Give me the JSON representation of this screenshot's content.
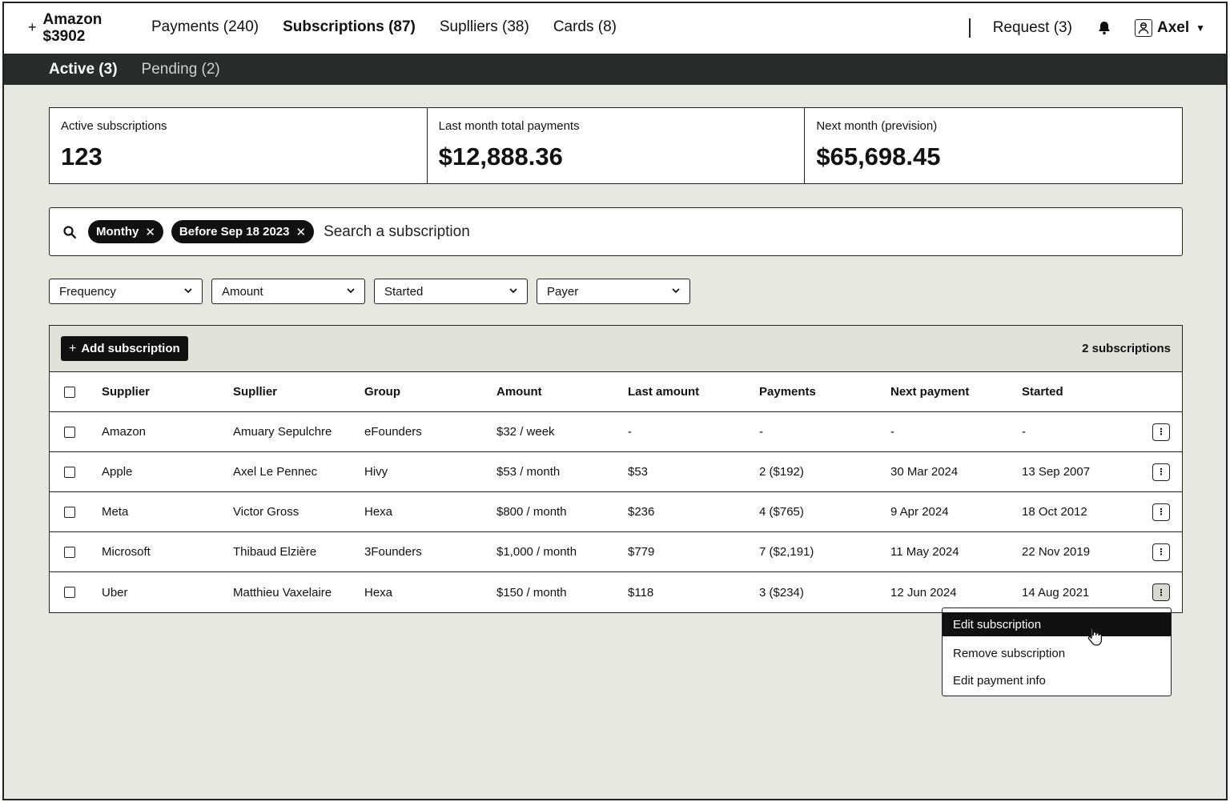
{
  "brand": {
    "line1": "Amazon",
    "line2": "$3902"
  },
  "nav": {
    "tabs": [
      {
        "label": "Payments (240)"
      },
      {
        "label": "Subscriptions (87)"
      },
      {
        "label": "Suplliers (38)"
      },
      {
        "label": "Cards (8)"
      }
    ],
    "request": "Request (3)",
    "user": "Axel"
  },
  "subnav": {
    "active": "Active (3)",
    "pending": "Pending (2)"
  },
  "stats": [
    {
      "label": "Active subscriptions",
      "value": "123"
    },
    {
      "label": "Last month total payments",
      "value": "$12,888.36"
    },
    {
      "label": "Next month (prevision)",
      "value": "$65,698.45"
    }
  ],
  "search": {
    "chips": [
      "Monthy",
      "Before Sep 18 2023"
    ],
    "placeholder": "Search a subscription"
  },
  "filters": [
    "Frequency",
    "Amount",
    "Started",
    "Payer"
  ],
  "table": {
    "add_label": "Add subscription",
    "count": "2 subscriptions",
    "columns": [
      "Supplier",
      "Supllier",
      "Group",
      "Amount",
      "Last amount",
      "Payments",
      "Next payment",
      "Started"
    ],
    "rows": [
      [
        "Amazon",
        "Amuary Sepulchre",
        "eFounders",
        "$32 / week",
        "-",
        "-",
        "-",
        "-"
      ],
      [
        "Apple",
        "Axel Le Pennec",
        "Hivy",
        "$53 / month",
        "$53",
        "2 ($192)",
        "30 Mar 2024",
        "13 Sep 2007"
      ],
      [
        "Meta",
        "Victor Gross",
        "Hexa",
        "$800 / month",
        "$236",
        "4 ($765)",
        "9 Apr 2024",
        "18 Oct 2012"
      ],
      [
        "Microsoft",
        "Thibaud Elzière",
        "3Founders",
        "$1,000 / month",
        "$779",
        "7 ($2,191)",
        "11 May 2024",
        "22 Nov 2019"
      ],
      [
        "Uber",
        "Matthieu Vaxelaire",
        "Hexa",
        "$150 / month",
        "$118",
        "3 ($234)",
        "12 Jun 2024",
        "14 Aug 2021"
      ]
    ]
  },
  "menu": {
    "items": [
      "Edit subscription",
      "Remove subscription",
      "Edit payment info"
    ]
  }
}
